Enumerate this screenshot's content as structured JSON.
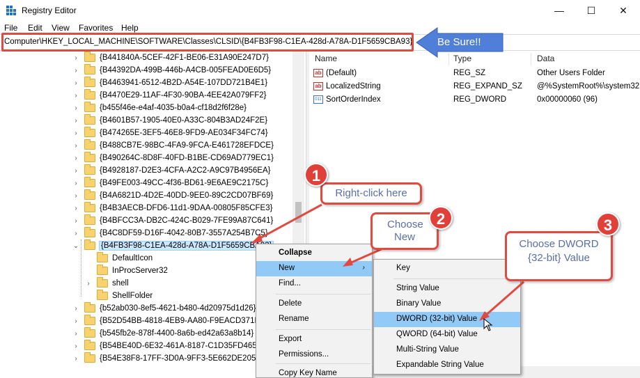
{
  "window": {
    "title": "Registry Editor",
    "min_glyph": "—",
    "max_glyph": "☐",
    "close_glyph": "✕"
  },
  "menu": [
    "File",
    "Edit",
    "View",
    "Favorites",
    "Help"
  ],
  "address": "Computer\\HKEY_LOCAL_MACHINE\\SOFTWARE\\Classes\\CLSID\\{B4FB3F98-C1EA-428d-A78A-D1F5659CBA93}",
  "tree": {
    "items": [
      "{B441840A-5CEF-42F1-BE06-E31A90E247D7}",
      "{B44392DA-499B-446b-A4CB-005FEAD0E6D5}",
      "{B4463941-6512-4B2D-A54E-107DD721B4E1}",
      "{B4470E29-11AF-4F30-90BA-4EE42A079FF2}",
      "{b455f46e-e4af-4035-b0a4-cf18d2f6f28e}",
      "{B4601B57-1905-40E0-A33C-804B3AD24F2E}",
      "{B474265E-3EF5-46E8-9FD9-AE034F34FC74}",
      "{B488CB7E-98BC-4FA9-9FCA-E461728EFDCE}",
      "{B490264C-8D8F-40FD-B1BE-CD69AD779EC1}",
      "{B4928187-D2E3-4CFA-A2C2-A9C97B4956EA}",
      "{B49FE003-49CC-4f36-BD61-9E6AE9C2175C}",
      "{B4A6821D-4D2E-40DD-9EE0-89C2CD07BF69}",
      "{B4B3AECB-DFD6-11d1-9DAA-00805F85CFE3}",
      "{B4BFCC3A-DB2C-424C-B029-7FE99A87C641}",
      "{B4C8DF59-D16F-4042-80B7-3557A254B7C5}"
    ],
    "selected": "{B4FB3F98-C1EA-428d-A78A-D1F5659CBA93}",
    "children": [
      "DefaultIcon",
      "InProcServer32",
      "shell",
      "ShellFolder"
    ],
    "after": [
      "{b52ab030-8ef5-4621-b480-4d20975d1d26}",
      "{B52D54BB-4818-4EB9-AA80-F9EACD371DF8}",
      "{b545fb2e-878f-4400-8a6b-ed42a63a8b14}",
      "{B54BE40D-6E32-461A-8187-C1D35FD4658B}",
      "{B54E38F8-17FF-3D0A-9FF3-5E662DE2055F}"
    ]
  },
  "values": {
    "columns": [
      "Name",
      "Type",
      "Data"
    ],
    "rows": [
      {
        "icon": "ab",
        "name": "(Default)",
        "type": "REG_SZ",
        "data": "Other Users Folder"
      },
      {
        "icon": "ab",
        "name": "LocalizedString",
        "type": "REG_EXPAND_SZ",
        "data": "@%SystemRoot%\\system32"
      },
      {
        "icon": "binary",
        "name": "SortOrderIndex",
        "type": "REG_DWORD",
        "data": "0x00000060 (96)"
      }
    ]
  },
  "context_menu": {
    "items": [
      "Collapse",
      "New",
      "Find...",
      "Delete",
      "Rename",
      "Export",
      "Permissions...",
      "Copy Key Name"
    ]
  },
  "submenu": {
    "items": [
      "Key",
      "String Value",
      "Binary Value",
      "DWORD (32-bit) Value",
      "QWORD (64-bit) Value",
      "Multi-String Value",
      "Expandable String Value"
    ]
  },
  "annotations": {
    "be_sure": "Be Sure!!",
    "step1_num": "1",
    "step1_text": "Right-click here",
    "step2_num": "2",
    "step2_text": "Choose New",
    "step3_num": "3",
    "step3_text": "Choose DWORD {32-bit} Value",
    "accent": "#e04a40",
    "arrow_blue": "#4f7fd8"
  }
}
